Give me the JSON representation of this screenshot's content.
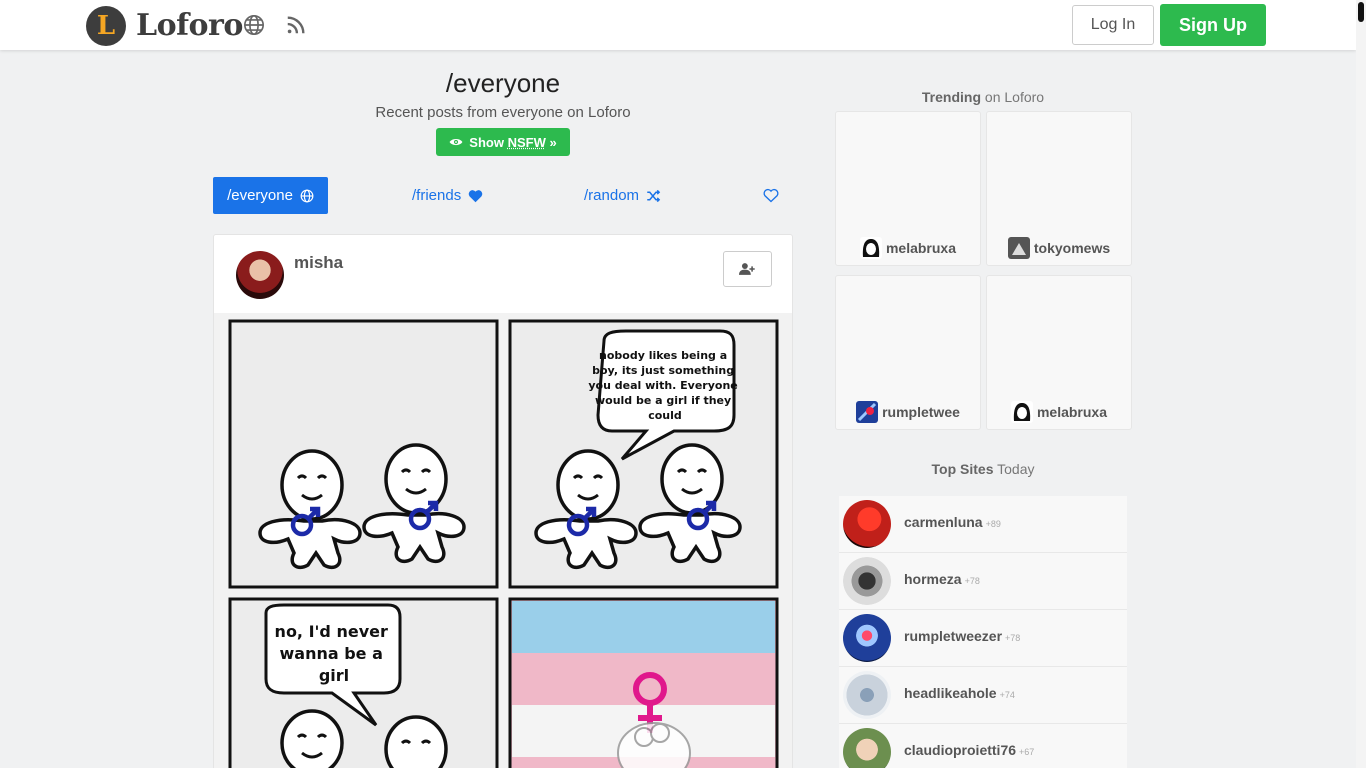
{
  "nav": {
    "logo_letter": "L",
    "logo_text": "Loforo",
    "login_label": "Log In",
    "signup_label": "Sign Up"
  },
  "header": {
    "title": "/everyone",
    "subtitle": "Recent posts from everyone on Loforo",
    "nsfw_prefix": "Show ",
    "nsfw_word": "NSFW",
    "nsfw_suffix": " »"
  },
  "tabs": {
    "everyone": "/everyone",
    "friends": "/friends",
    "random": "/random"
  },
  "post": {
    "username": "misha",
    "comic": {
      "bubble1": [
        "nobody likes being a",
        "boy, its just something",
        "you deal with. Everyone",
        "would be a girl if they",
        "could"
      ],
      "bubble2": [
        "no, I'd never",
        "wanna be a",
        "girl"
      ]
    }
  },
  "trending": {
    "heading_bold": "Trending",
    "heading_rest": " on Loforo",
    "items": [
      {
        "user": "melabruxa"
      },
      {
        "user": "tokyomews"
      },
      {
        "user": "rumpletwee"
      },
      {
        "user": "melabruxa"
      }
    ]
  },
  "top_sites": {
    "heading_bold": "Top Sites",
    "heading_rest": " Today",
    "items": [
      {
        "name": "carmenluna",
        "count": "+89",
        "color": "#c0201a"
      },
      {
        "name": "hormeza",
        "count": "+78",
        "color": "#777777"
      },
      {
        "name": "rumpletweezer",
        "count": "+78",
        "color": "#1f3f9a"
      },
      {
        "name": "headlikeahole",
        "count": "+74",
        "color": "#c9d2dc"
      },
      {
        "name": "claudioproietti76",
        "count": "+67",
        "color": "#6c8f4f"
      }
    ]
  },
  "colors": {
    "brand_green": "#2dba4e",
    "link_blue": "#1a73e8",
    "male_symbol": "#1c2aa8",
    "female_symbol": "#e0188c",
    "flag_blue": "#9acfea",
    "flag_pink": "#f0b8c8"
  }
}
